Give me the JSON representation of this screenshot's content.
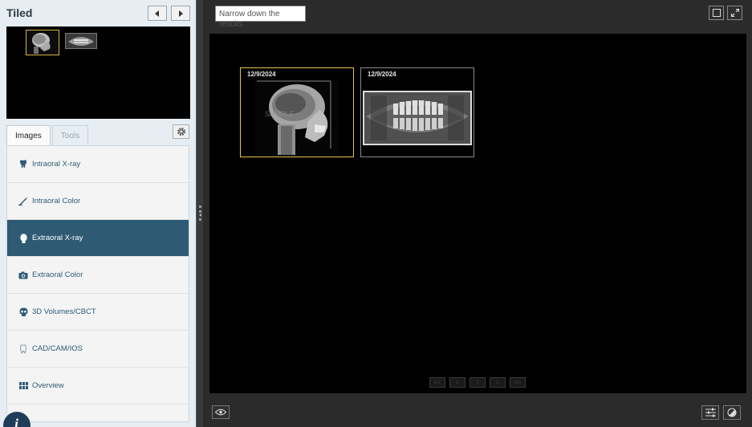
{
  "panel": {
    "title": "Tiled"
  },
  "tabs": [
    {
      "label": "Images",
      "active": true
    },
    {
      "label": "Tools",
      "active": false
    }
  ],
  "categories": [
    {
      "label": "Intraoral X-ray",
      "icon": "tooth-icon"
    },
    {
      "label": "Intraoral Color",
      "icon": "brush-icon"
    },
    {
      "label": "Extraoral X-ray",
      "icon": "head-icon",
      "active": true
    },
    {
      "label": "Extraoral Color",
      "icon": "camera-icon"
    },
    {
      "label": "3D Volumes/CBCT",
      "icon": "skull-icon"
    },
    {
      "label": "CAD/CAM/IOS",
      "icon": "crown-icon"
    },
    {
      "label": "Overview",
      "icon": "grid-icon"
    }
  ],
  "search": {
    "text": "Narrow down the results"
  },
  "images": [
    {
      "date": "12/9/2024",
      "type": "cephalometric",
      "selected": true
    },
    {
      "date": "12/9/2024",
      "type": "panoramic",
      "selected": false
    }
  ],
  "pager": {
    "first": "<<",
    "prev": "<",
    "page": "1",
    "next": ">",
    "last": ">>"
  },
  "colors": {
    "accent": "#2e5a74",
    "selection": "#e2c454",
    "info": "#1f3c5a"
  }
}
